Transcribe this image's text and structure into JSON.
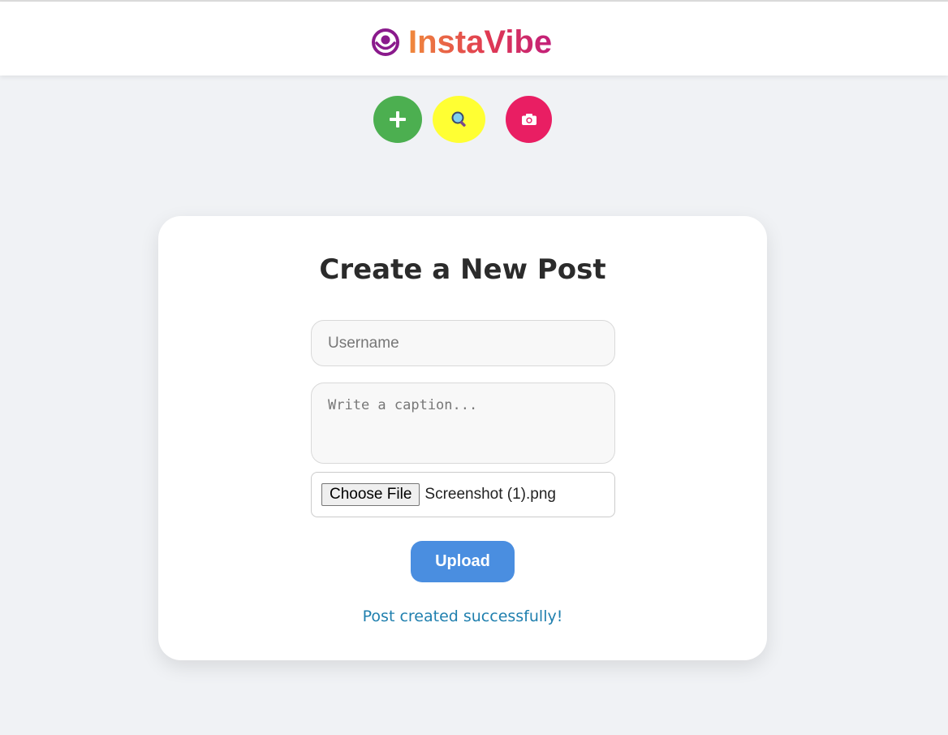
{
  "header": {
    "app_name": "InstaVibe",
    "logo_icon": "smiley-icon",
    "gradient": [
      "#f08a3c",
      "#e03a52",
      "#c21f7a"
    ]
  },
  "actions": [
    {
      "icon": "plus-icon",
      "color": "#4caf50"
    },
    {
      "icon": "magnifier-icon",
      "color": "#ffff33"
    },
    {
      "icon": "camera-icon",
      "color": "#e91e63"
    }
  ],
  "form": {
    "title": "Create a New Post",
    "username_placeholder": "Username",
    "username_value": "",
    "caption_placeholder": "Write a caption...",
    "caption_value": "",
    "choose_file_label": "Choose File",
    "file_name": "Screenshot (1).png",
    "upload_label": "Upload",
    "upload_color": "#4a8ee0"
  },
  "status": {
    "message": "Post created successfully!",
    "color": "#1f7fae"
  }
}
